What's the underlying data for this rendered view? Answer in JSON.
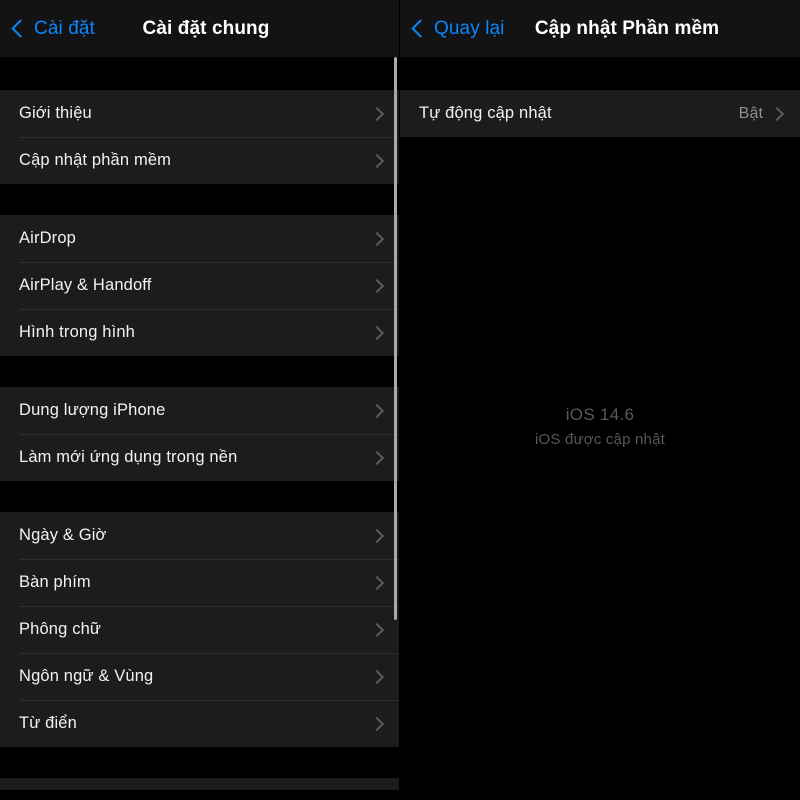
{
  "left_panel": {
    "navbar": {
      "back_label": "Cài đặt",
      "title": "Cài đặt chung"
    },
    "groups": [
      {
        "rows": [
          {
            "label": "Giới thiệu",
            "value": "",
            "disclosure": true
          },
          {
            "label": "Cập nhật phần mềm",
            "value": "",
            "disclosure": true
          }
        ]
      },
      {
        "rows": [
          {
            "label": "AirDrop",
            "value": "",
            "disclosure": true
          },
          {
            "label": "AirPlay & Handoff",
            "value": "",
            "disclosure": true
          },
          {
            "label": "Hình trong hình",
            "value": "",
            "disclosure": true
          }
        ]
      },
      {
        "rows": [
          {
            "label": "Dung lượng iPhone",
            "value": "",
            "disclosure": true
          },
          {
            "label": "Làm mới ứng dụng trong nền",
            "value": "",
            "disclosure": true
          }
        ]
      },
      {
        "rows": [
          {
            "label": "Ngày & Giờ",
            "value": "",
            "disclosure": true
          },
          {
            "label": "Bàn phím",
            "value": "",
            "disclosure": true
          },
          {
            "label": "Phông chữ",
            "value": "",
            "disclosure": true
          },
          {
            "label": "Ngôn ngữ & Vùng",
            "value": "",
            "disclosure": true
          },
          {
            "label": "Từ điển",
            "value": "",
            "disclosure": true
          }
        ]
      }
    ]
  },
  "right_panel": {
    "navbar": {
      "back_label": "Quay lại",
      "title": "Cập nhật Phần mềm"
    },
    "groups": [
      {
        "rows": [
          {
            "label": "Tự động cập nhật",
            "value": "Bật",
            "disclosure": true
          }
        ]
      }
    ],
    "status": {
      "version": "iOS 14.6",
      "subtitle": "iOS được cập nhật"
    }
  },
  "colors": {
    "accent_blue": "#0a84ff",
    "row_background": "#1c1c1e",
    "page_background": "#000000",
    "navbar_background": "#131313",
    "separator": "#2e2e30",
    "primary_text": "#f2f2f4",
    "secondary_text": "#8e8e93",
    "muted_text": "#58585c",
    "chevron": "#5a5a5e",
    "scrollbar": "#a9a9ab"
  }
}
